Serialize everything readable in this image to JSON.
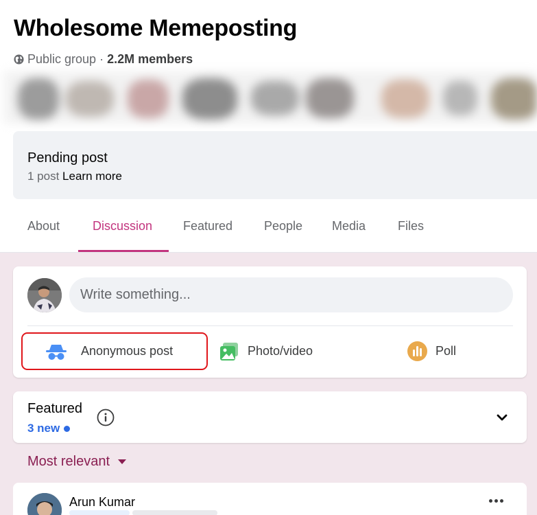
{
  "group": {
    "title": "Wholesome Memeposting",
    "privacy": "Public group",
    "separator": "·",
    "members": "2.2M members"
  },
  "pending": {
    "title": "Pending post",
    "count": "1 post",
    "link": "Learn more"
  },
  "tabs": [
    {
      "label": "About"
    },
    {
      "label": "Discussion",
      "active": true
    },
    {
      "label": "Featured"
    },
    {
      "label": "People"
    },
    {
      "label": "Media"
    },
    {
      "label": "Files"
    }
  ],
  "composer": {
    "placeholder": "Write something...",
    "actions": {
      "anonymous": "Anonymous post",
      "photo": "Photo/video",
      "poll": "Poll"
    },
    "icons": {
      "anonymous": "incognito-icon",
      "photo": "photo-icon",
      "poll": "poll-icon"
    }
  },
  "featured": {
    "title": "Featured",
    "new_count": "3 new"
  },
  "sort": {
    "label": "Most relevant"
  },
  "post": {
    "author": "Arun Kumar"
  },
  "colors": {
    "accent": "#c2347e",
    "feed_background": "#f2e6ec",
    "link_blue": "#2d6ae3",
    "highlight_border": "#e0161b",
    "sort_text": "#8a1f52"
  }
}
